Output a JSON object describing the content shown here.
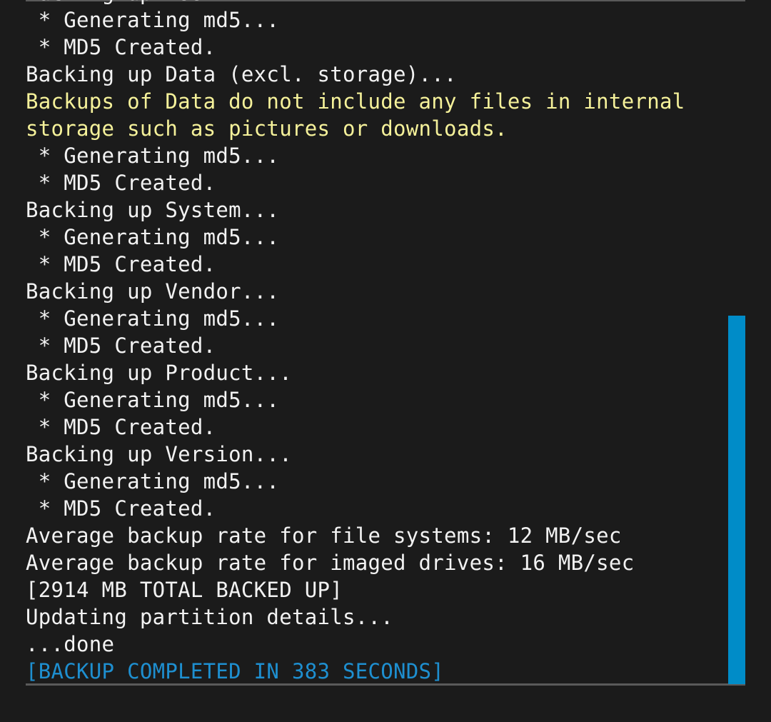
{
  "console": {
    "lines": [
      {
        "text": "Backing up Boot...",
        "kind": "normal"
      },
      {
        "text": " * Generating md5...",
        "kind": "normal"
      },
      {
        "text": " * MD5 Created.",
        "kind": "normal"
      },
      {
        "text": "Backing up Data (excl. storage)...",
        "kind": "normal"
      },
      {
        "text": "Backups of Data do not include any files in internal",
        "kind": "warn"
      },
      {
        "text": "storage such as pictures or downloads.",
        "kind": "warn"
      },
      {
        "text": " * Generating md5...",
        "kind": "normal"
      },
      {
        "text": " * MD5 Created.",
        "kind": "normal"
      },
      {
        "text": "Backing up System...",
        "kind": "normal"
      },
      {
        "text": " * Generating md5...",
        "kind": "normal"
      },
      {
        "text": " * MD5 Created.",
        "kind": "normal"
      },
      {
        "text": "Backing up Vendor...",
        "kind": "normal"
      },
      {
        "text": " * Generating md5...",
        "kind": "normal"
      },
      {
        "text": " * MD5 Created.",
        "kind": "normal"
      },
      {
        "text": "Backing up Product...",
        "kind": "normal"
      },
      {
        "text": " * Generating md5...",
        "kind": "normal"
      },
      {
        "text": " * MD5 Created.",
        "kind": "normal"
      },
      {
        "text": "Backing up Version...",
        "kind": "normal"
      },
      {
        "text": " * Generating md5...",
        "kind": "normal"
      },
      {
        "text": " * MD5 Created.",
        "kind": "normal"
      },
      {
        "text": "Average backup rate for file systems: 12 MB/sec",
        "kind": "normal"
      },
      {
        "text": "Average backup rate for imaged drives: 16 MB/sec",
        "kind": "normal"
      },
      {
        "text": "[2914 MB TOTAL BACKED UP]",
        "kind": "normal"
      },
      {
        "text": "Updating partition details...",
        "kind": "normal"
      },
      {
        "text": "...done",
        "kind": "normal"
      },
      {
        "text": "[BACKUP COMPLETED IN 383 SECONDS]",
        "kind": "done"
      }
    ]
  },
  "colors": {
    "background": "#1b1b1b",
    "text": "#f2f2f2",
    "warning": "#f5f19a",
    "highlight": "#1e8fd0",
    "scrollbar": "#008cc8"
  }
}
